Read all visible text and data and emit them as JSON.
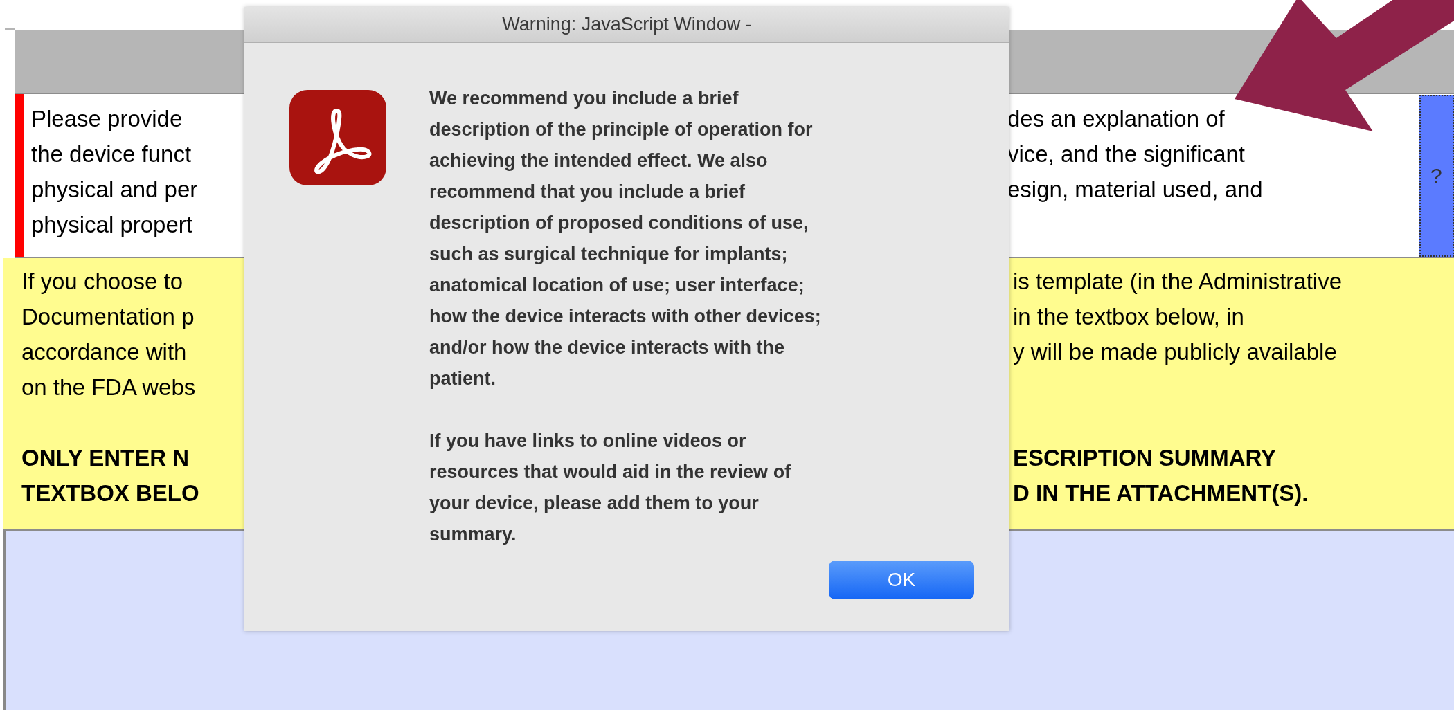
{
  "form": {
    "description_row": {
      "left_lines": [
        "Please provide",
        "the device funct",
        "physical and per",
        "physical propert"
      ],
      "right_lines": [
        "des an explanation of",
        "vice, and the significant",
        "esign, material used, and"
      ],
      "help_button": "?"
    },
    "notice": {
      "left_lines": [
        "If you choose to",
        "Documentation p",
        "accordance with",
        "on the FDA webs"
      ],
      "right_lines": [
        "is template (in the Administrative",
        "in the textbox below, in",
        "y will be made publicly available"
      ],
      "bold_left": [
        "ONLY ENTER N",
        "TEXTBOX BELO"
      ],
      "bold_right": [
        "ESCRIPTION SUMMARY",
        "D IN THE ATTACHMENT(S)."
      ]
    }
  },
  "dialog": {
    "title": "Warning: JavaScript Window -",
    "paragraphs": [
      "We recommend you include a brief\ndescription of the principle of operation for\nachieving the intended effect. We also\nrecommend that you include a brief\ndescription of proposed conditions of use,\nsuch as surgical technique for implants;\nanatomical location of use; user interface;\nhow the device interacts with other devices;\nand/or how the device interacts with the\npatient.",
      "If you have links to online videos or\nresources that would aid in the review of\nyour device, please add them to your\nsummary."
    ],
    "button": "OK"
  }
}
